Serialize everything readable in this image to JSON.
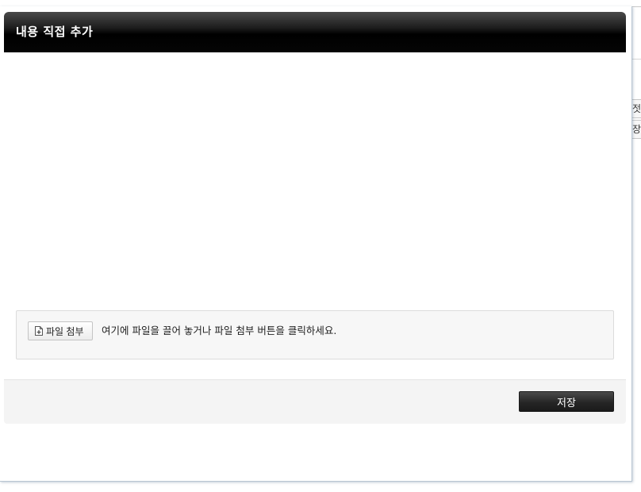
{
  "modal": {
    "title": "내용 직접 추가",
    "attach": {
      "button_label": "파일 첨부",
      "icon": "file-plus-icon",
      "hint": "여기에 파일을 끌어 놓거나 파일 첨부 버튼을 클릭하세요."
    },
    "footer": {
      "save_label": "저장"
    }
  },
  "background": {
    "fragment_1": "젓",
    "fragment_2": "장"
  },
  "colors": {
    "header_dark": "#000000",
    "button_dark": "#262626",
    "footer_bg": "#f4f4f4",
    "dropzone_bg": "#f7f7f7"
  }
}
